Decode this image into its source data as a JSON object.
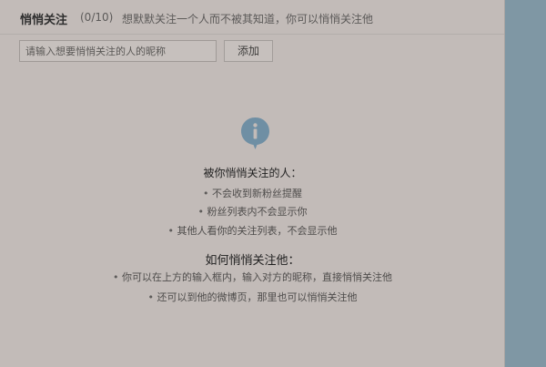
{
  "dialog": {
    "title": "悄悄关注",
    "count": "(0/10)",
    "description": "想默默关注一个人而不被其知道，你可以悄悄关注他"
  },
  "form": {
    "input_placeholder": "请输入想要悄悄关注的人的昵称",
    "input_value": "",
    "add_label": "添加"
  },
  "info": {
    "icon": "info-icon",
    "section1": {
      "heading": "被你悄悄关注的人：",
      "items": [
        "不会收到新粉丝提醒",
        "粉丝列表内不会显示你",
        "其他人看你的关注列表，不会显示他"
      ]
    },
    "section2": {
      "heading": "如何悄悄关注他：",
      "items": [
        "你可以在上方的输入框内，输入对方的昵称，直接悄悄关注他",
        "还可以到他的微博页，那里也可以悄悄关注他"
      ]
    },
    "bullet": "•"
  },
  "colors": {
    "background": "#7f97a4",
    "dialog": "#c2bbb8",
    "icon": "#6f8fa4"
  }
}
